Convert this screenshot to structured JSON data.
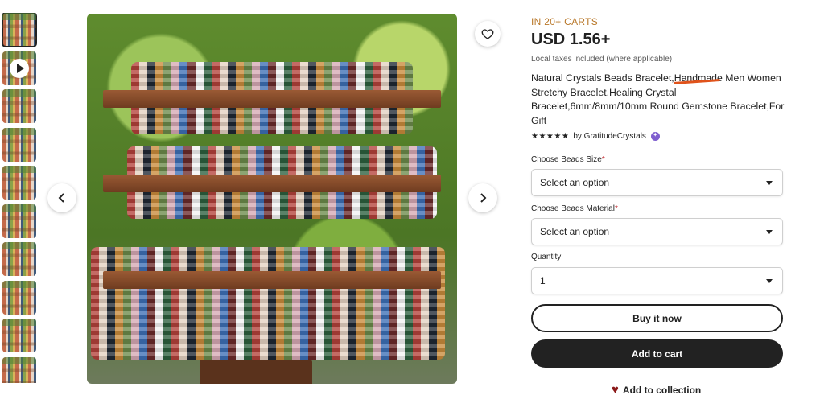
{
  "gallery": {
    "thumbnails": [
      {
        "type": "image",
        "active": true
      },
      {
        "type": "video"
      },
      {
        "type": "image"
      },
      {
        "type": "image"
      },
      {
        "type": "image"
      },
      {
        "type": "image"
      },
      {
        "type": "image"
      },
      {
        "type": "image"
      },
      {
        "type": "image"
      },
      {
        "type": "image"
      }
    ],
    "prev_icon": "chevron-left-icon",
    "next_icon": "chevron-right-icon",
    "favorite_icon": "heart-outline-icon"
  },
  "listing": {
    "carts_badge": "IN 20+ CARTS",
    "price": "USD 1.56+",
    "taxes_note": "Local taxes included (where applicable)",
    "title": "Natural Crystals Beads Bracelet,Handmade Men Women Stretchy Bracelet,Healing Crystal Bracelet,6mm/8mm/10mm Round Gemstone Bracelet,For Gift",
    "stars": "★★★★★",
    "seller": "by GratitudeCrystals",
    "annotation_color": "#e0531b"
  },
  "options": {
    "size_label": "Choose Beads Size",
    "size_value": "Select an option",
    "material_label": "Choose Beads Material",
    "material_value": "Select an option",
    "required_mark": "*",
    "quantity_label": "Quantity",
    "quantity_value": "1"
  },
  "actions": {
    "buy_now": "Buy it now",
    "add_to_cart": "Add to cart",
    "add_to_collection": "Add to collection"
  },
  "colors": {
    "carts_badge": "#b9782a",
    "primary_button": "#222222",
    "required": "#c1272d",
    "collection_heart": "#8b1a1a"
  }
}
